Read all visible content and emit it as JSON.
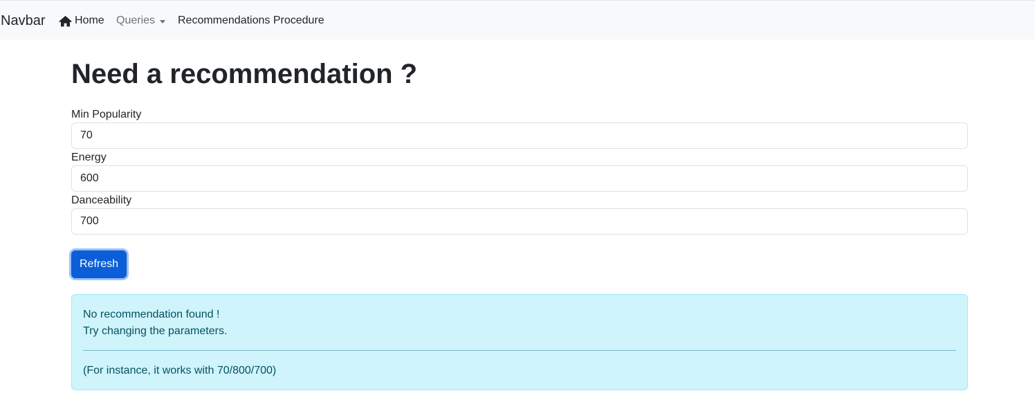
{
  "navbar": {
    "brand": "Navbar",
    "home": "Home",
    "queries": "Queries",
    "procedure": "Recommendations Procedure"
  },
  "page": {
    "title": "Need a recommendation ?"
  },
  "form": {
    "min_popularity_label": "Min Popularity",
    "min_popularity_value": "70",
    "energy_label": "Energy",
    "energy_value": "600",
    "danceability_label": "Danceability",
    "danceability_value": "700",
    "refresh_label": "Refresh"
  },
  "alert": {
    "line1": "No recommendation found !",
    "line2": "Try changing the parameters.",
    "note": "(For instance, it works with 70/800/700)"
  },
  "icons": {
    "home": "home-icon",
    "dropdown": "caret-down-icon"
  },
  "colors": {
    "primary": "#0b5ed7",
    "alert_bg": "#cff4fc",
    "alert_text": "#055160",
    "navbar_bg": "#f8f9fa"
  }
}
